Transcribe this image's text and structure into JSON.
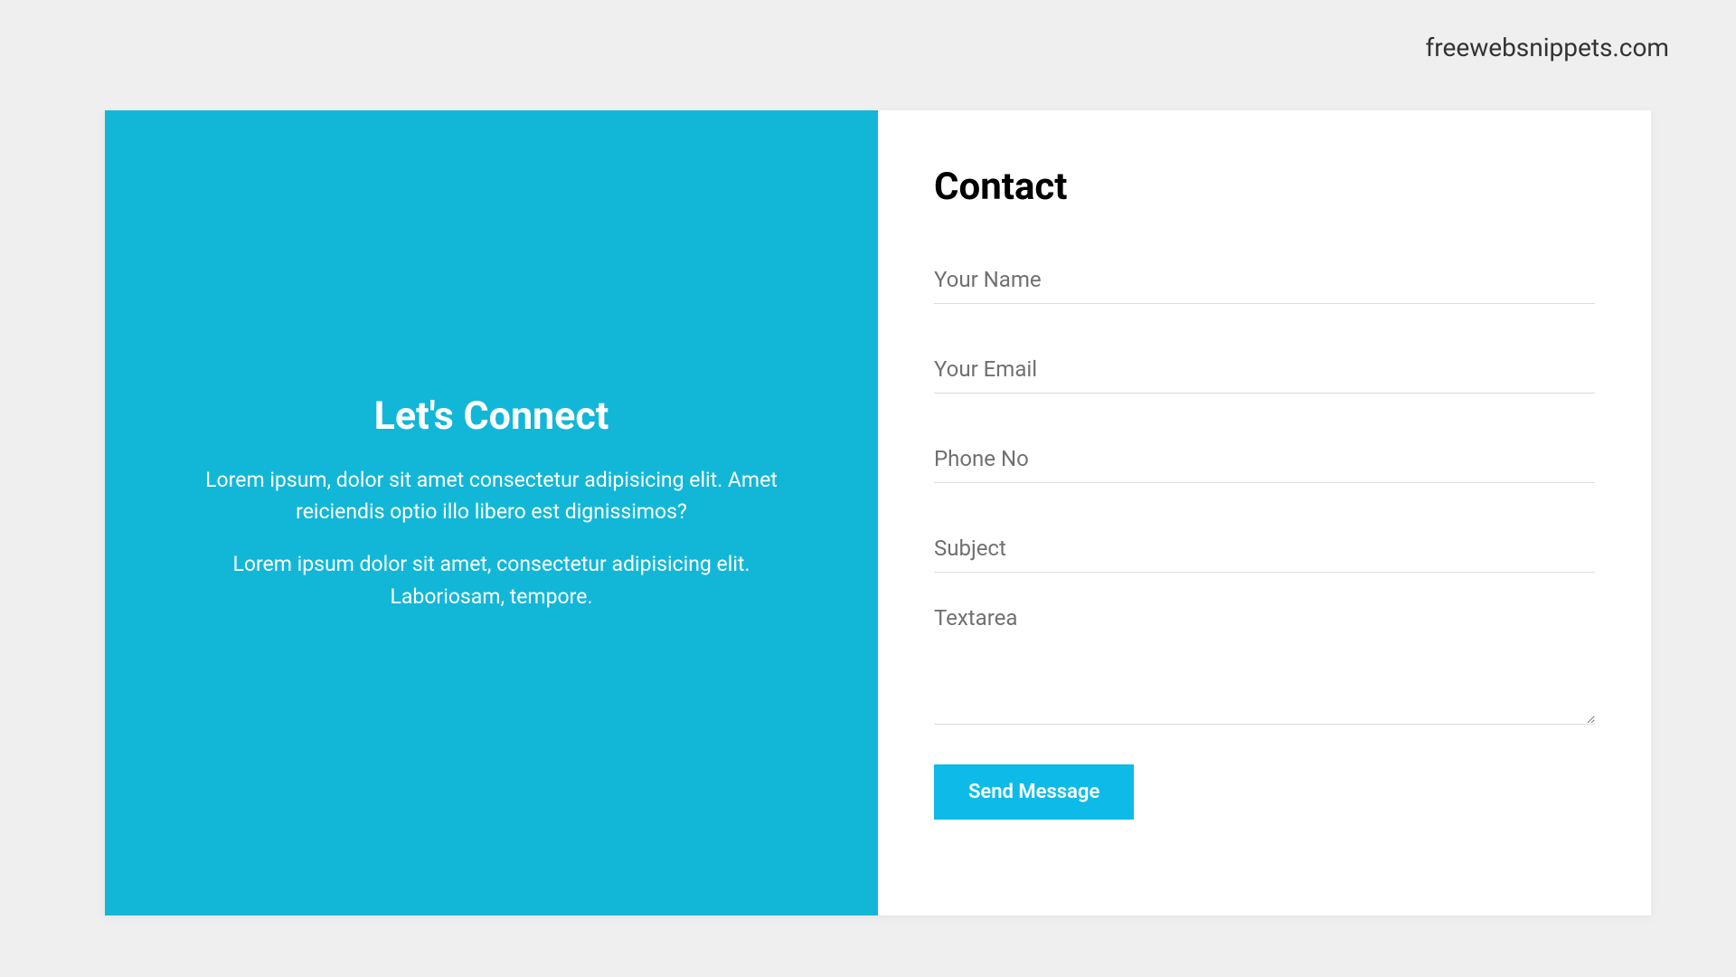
{
  "brand": "freewebsnippets.com",
  "left": {
    "heading": "Let's Connect",
    "paragraph1": "Lorem ipsum, dolor sit amet consectetur adipisicing elit. Amet reiciendis optio illo libero est dignissimos?",
    "paragraph2": "Lorem ipsum dolor sit amet, consectetur adipisicing elit. Laboriosam, tempore."
  },
  "right": {
    "heading": "Contact",
    "fields": {
      "name_placeholder": "Your Name",
      "email_placeholder": "Your Email",
      "phone_placeholder": "Phone No",
      "subject_placeholder": "Subject",
      "message_placeholder": "Textarea"
    },
    "submit_label": "Send Message"
  },
  "colors": {
    "accent": "#12b7d8",
    "button": "#0ebbe8",
    "background": "#efefef"
  }
}
